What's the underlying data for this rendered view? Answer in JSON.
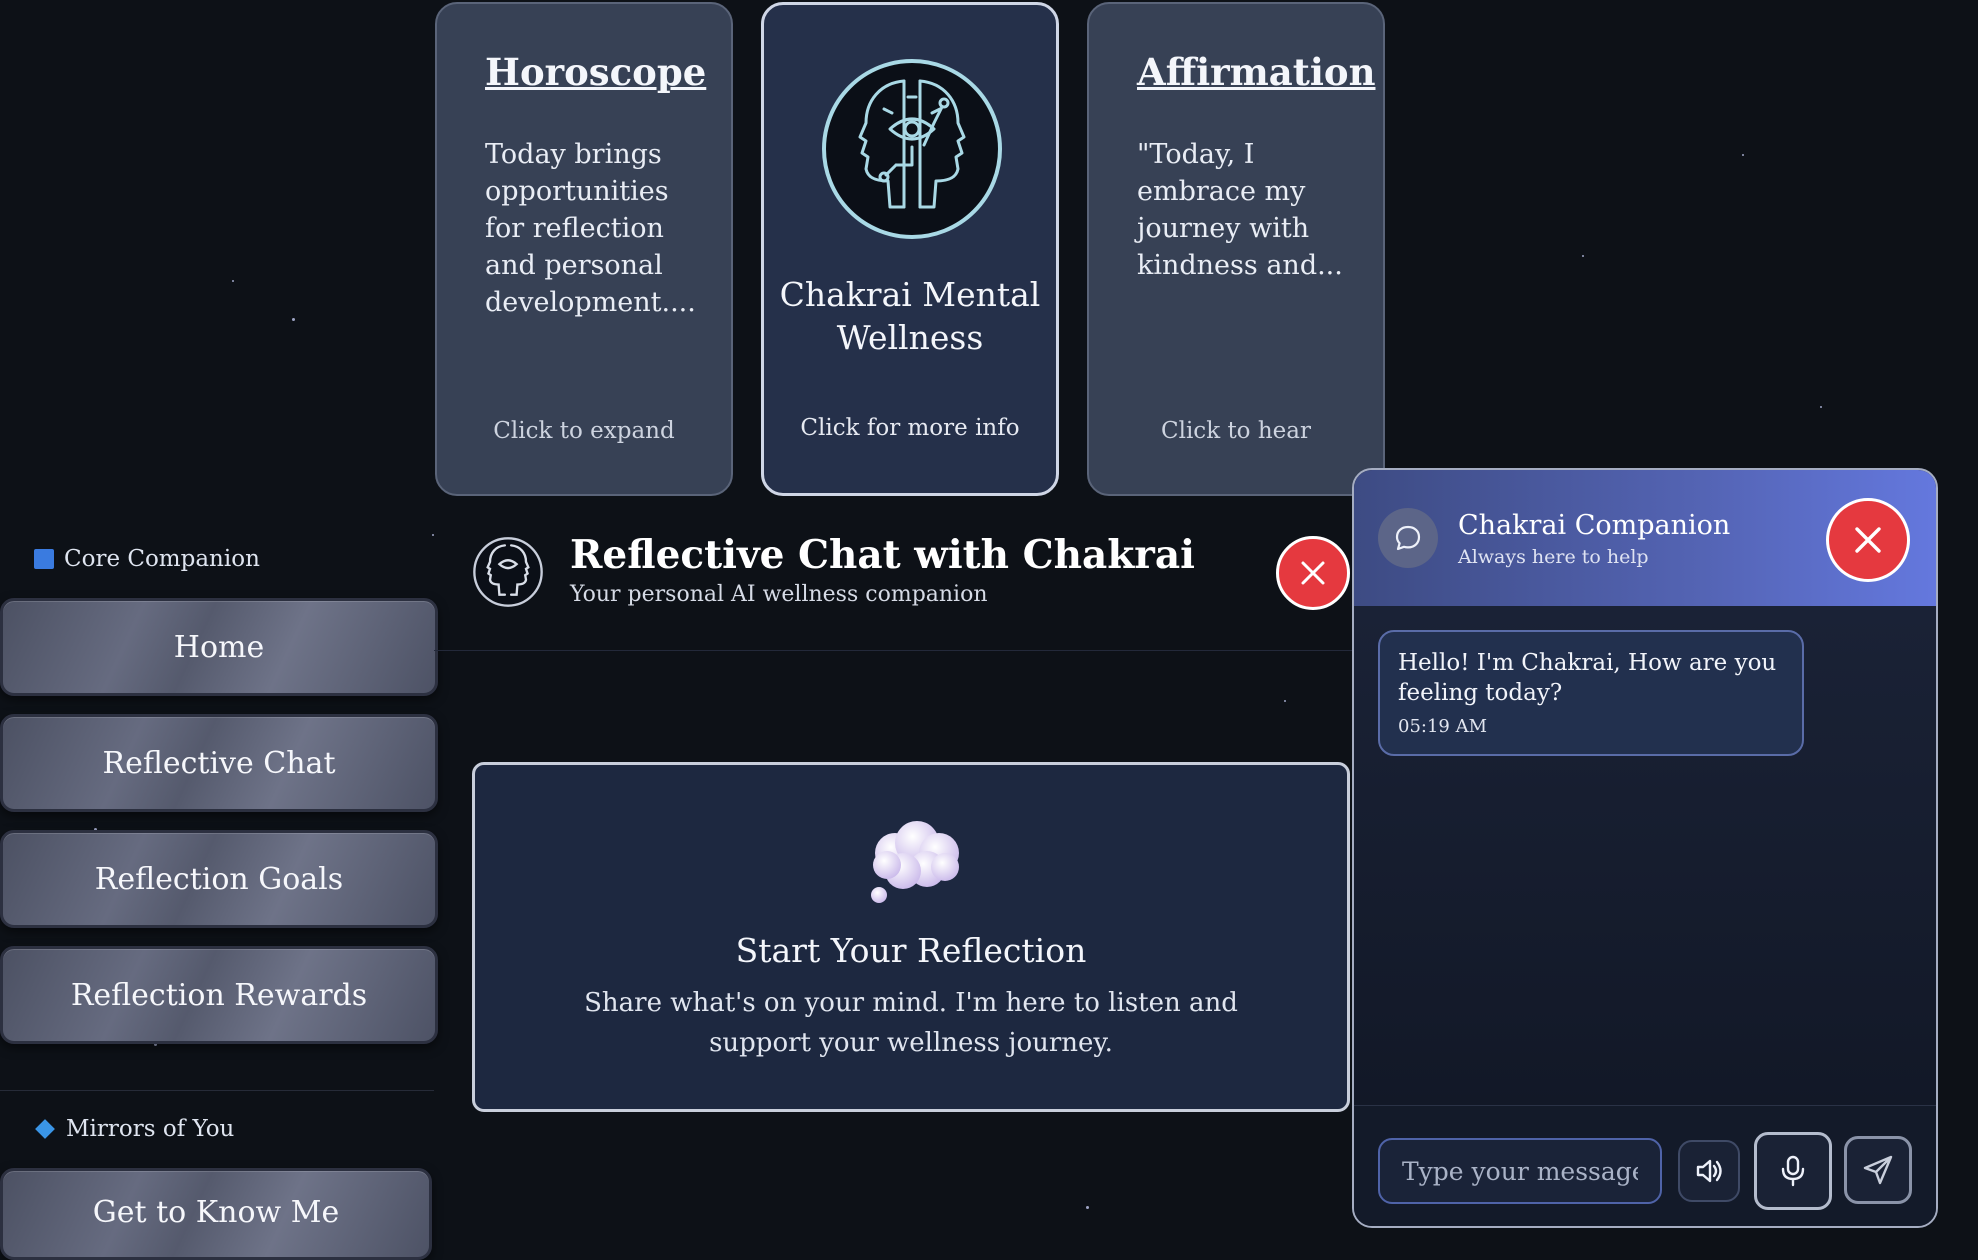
{
  "sidebar": {
    "section1": "Core Companion",
    "items": [
      "Home",
      "Reflective Chat",
      "Reflection Goals",
      "Reflection Rewards"
    ],
    "section2": "Mirrors of You",
    "items2": [
      "Get to Know Me"
    ]
  },
  "cards": {
    "horoscope": {
      "title": "Horoscope",
      "text": "Today brings opportunities for reflection and personal development....",
      "hint": "Click to expand"
    },
    "center": {
      "title": "Chakrai Mental Wellness",
      "hint": "Click for more info"
    },
    "affirmation": {
      "title": "Affirmation",
      "text": "\"Today, I embrace my journey with kindness and...",
      "hint": "Click to hear"
    }
  },
  "chat": {
    "title": "Reflective Chat with Chakrai",
    "subtitle": "Your personal AI wellness companion",
    "empty_title": "Start Your Reflection",
    "empty_text": "Share what's on your mind. I'm here to listen and support your wellness journey."
  },
  "companion": {
    "name": "Chakrai Companion",
    "status": "Always here to help",
    "message": "Hello! I'm Chakrai, How are you feeling today?",
    "time": "05:19 AM",
    "input_placeholder": "Type your message..."
  },
  "colors": {
    "accent_red": "#e5393f",
    "panel_gradient_end": "#6478de",
    "bg": "#0d1117"
  },
  "icons": [
    "chakrai-logo-icon",
    "thought-cloud-icon",
    "chat-bubble-icon",
    "close-icon",
    "speaker-icon",
    "microphone-icon",
    "send-icon"
  ]
}
